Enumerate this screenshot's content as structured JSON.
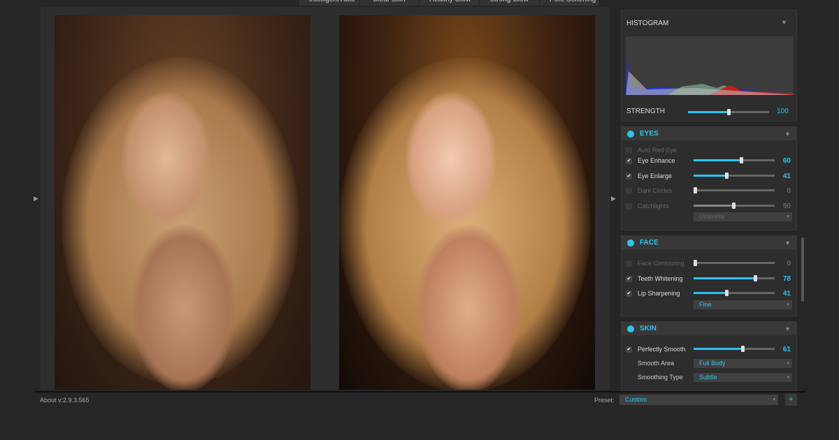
{
  "tabs": [
    "Intelligent Auto",
    "Clear Skin",
    "Healthy Glow",
    "Strong Glow",
    "Pore Softening"
  ],
  "histogram": {
    "title": "HISTOGRAM"
  },
  "strength": {
    "label": "STRENGTH",
    "value": 100,
    "fraction": 1.0
  },
  "eyes": {
    "title": "EYES",
    "rows": [
      {
        "label": "Auto Red-Eye",
        "checked": false,
        "enabled": false
      },
      {
        "label": "Eye Enhance",
        "checked": true,
        "enabled": true,
        "value": "60",
        "pct": 60
      },
      {
        "label": "Eye Enlarge",
        "checked": true,
        "enabled": true,
        "value": "41",
        "pct": 41
      },
      {
        "label": "Dark Circles",
        "checked": false,
        "enabled": false,
        "value": "0",
        "pct": 0
      },
      {
        "label": "Catchlights",
        "checked": false,
        "enabled": false,
        "value": "50",
        "pct": 50
      }
    ],
    "catchlight_type": "Umbrella"
  },
  "face": {
    "title": "FACE",
    "rows": [
      {
        "label": "Face Contouring",
        "checked": false,
        "enabled": false,
        "value": "0",
        "pct": 0
      },
      {
        "label": "Teeth Whitening",
        "checked": true,
        "enabled": true,
        "value": "78",
        "pct": 78
      },
      {
        "label": "Lip Sharpening",
        "checked": true,
        "enabled": true,
        "value": "41",
        "pct": 41
      }
    ],
    "lip_mode": "Fine"
  },
  "skin": {
    "title": "SKIN",
    "perfectly_smooth": {
      "label": "Perfectly Smooth",
      "value": "61",
      "pct": 61
    },
    "smooth_area_label": "Smooth Area",
    "smooth_area": "Full Body",
    "smoothing_type_label": "Smoothing Type",
    "smoothing_type": "Subtle"
  },
  "footer": {
    "about": "About v:2.9.3.565",
    "preset_label": "Preset:",
    "preset": "Custom",
    "add": "+"
  },
  "colors": {
    "accent": "#2ec4ef"
  }
}
